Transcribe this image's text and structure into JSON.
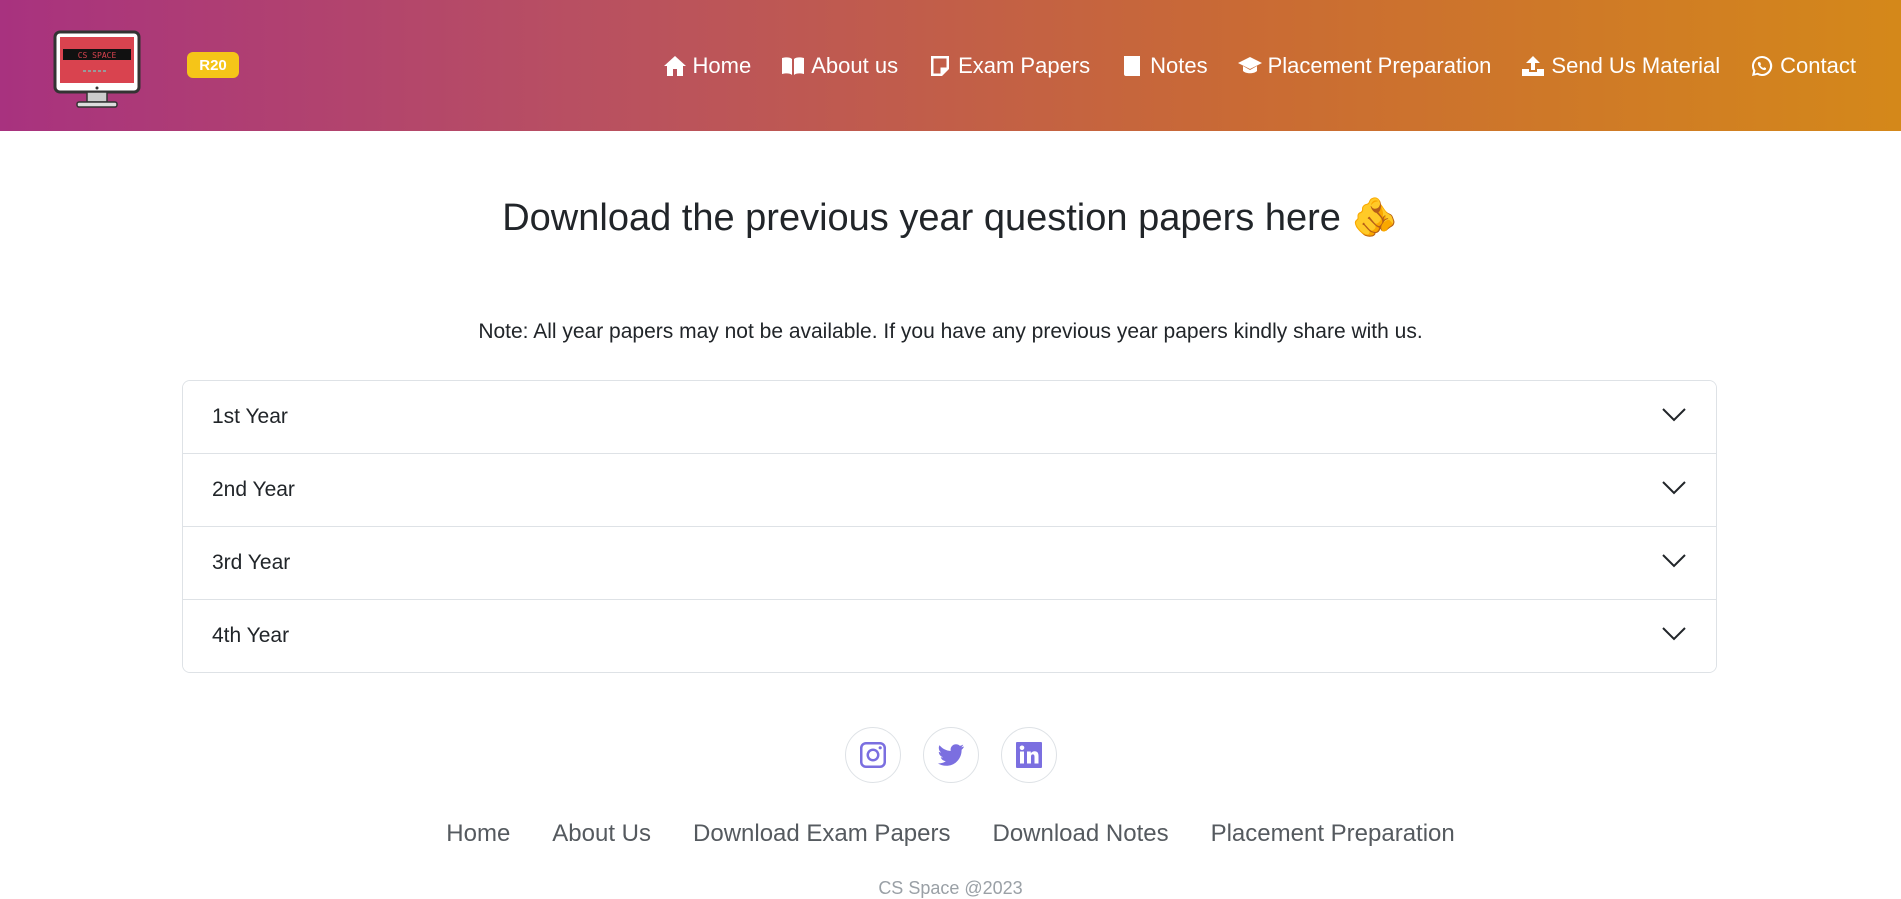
{
  "header": {
    "logo_text": "CS SPACE",
    "badge": "R20",
    "nav": [
      {
        "label": "Home",
        "icon": "home-icon"
      },
      {
        "label": "About us",
        "icon": "book-open-icon"
      },
      {
        "label": "Exam Papers",
        "icon": "sticky-note-icon"
      },
      {
        "label": "Notes",
        "icon": "book-icon"
      },
      {
        "label": "Placement Preparation",
        "icon": "graduation-cap-icon"
      },
      {
        "label": "Send Us Material",
        "icon": "upload-icon"
      },
      {
        "label": "Contact",
        "icon": "whatsapp-icon"
      }
    ],
    "gradient_start": "#a8327f",
    "gradient_end": "#d4881a",
    "badge_color": "#f5c518"
  },
  "main": {
    "title": "Download the previous year question papers here 🫵",
    "note": "Note: All year papers may not be available. If you have any previous year papers kindly share with us.",
    "accordion": [
      {
        "label": "1st Year"
      },
      {
        "label": "2nd Year"
      },
      {
        "label": "3rd Year"
      },
      {
        "label": "4th Year"
      }
    ]
  },
  "footer": {
    "social": [
      {
        "icon": "instagram-icon"
      },
      {
        "icon": "twitter-icon"
      },
      {
        "icon": "linkedin-icon"
      }
    ],
    "social_color": "#7b6fe0",
    "links": [
      "Home",
      "About Us",
      "Download Exam Papers",
      "Download Notes",
      "Placement Preparation"
    ],
    "copyright": "CS Space @2023"
  }
}
